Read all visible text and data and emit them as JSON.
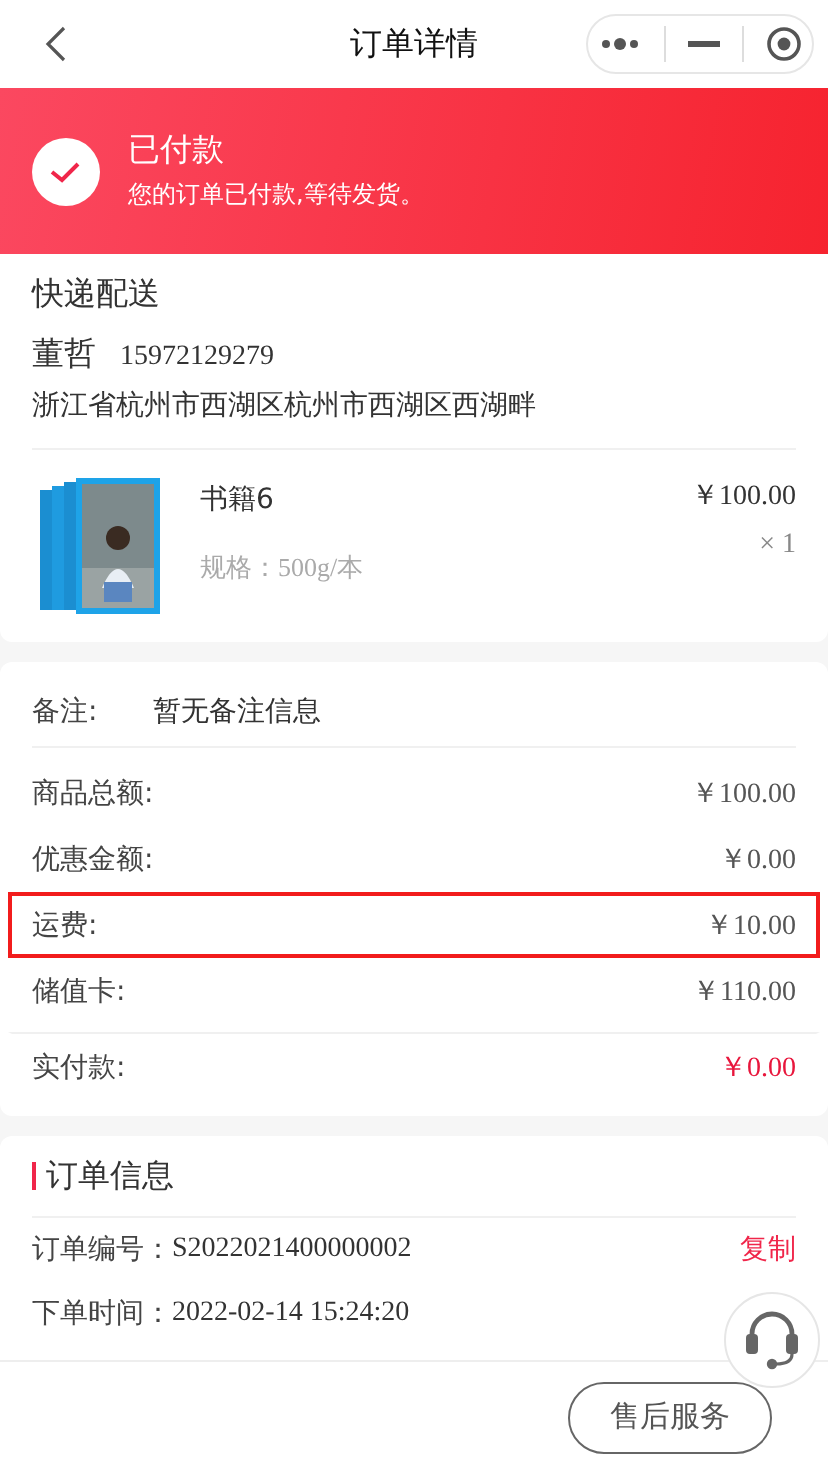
{
  "nav": {
    "title": "订单详情"
  },
  "status": {
    "title": "已付款",
    "message": "您的订单已付款,等待发货。"
  },
  "delivery": {
    "method": "快递配送",
    "name": "董哲",
    "phone": "15972129279",
    "address": "浙江省杭州市西湖区杭州市西湖区西湖畔"
  },
  "product": {
    "name": "书籍6",
    "spec": "规格：500g/本",
    "price": "￥100.00",
    "quantity": "× 1"
  },
  "remark": {
    "label": "备注:",
    "value": "暂无备注信息"
  },
  "fees": [
    {
      "label": "商品总额:",
      "value": "￥100.00",
      "kind": "normal",
      "highlighted": false
    },
    {
      "label": "优惠金额:",
      "value": "￥0.00",
      "kind": "normal",
      "highlighted": false
    },
    {
      "label": "运费:",
      "value": "￥10.00",
      "kind": "normal",
      "highlighted": true
    },
    {
      "label": "储值卡:",
      "value": "￥110.00",
      "kind": "normal",
      "highlighted": false
    },
    {
      "label": "实付款:",
      "value": "￥0.00",
      "kind": "total",
      "highlighted": false
    }
  ],
  "order_info": {
    "title": "订单信息",
    "rows": [
      {
        "label": "订单编号：",
        "value": "S2022021400000002",
        "action": "复制"
      },
      {
        "label": "下单时间：",
        "value": "2022-02-14 15:24:20"
      }
    ]
  },
  "bottom_bar": {
    "button": "售后服务"
  }
}
